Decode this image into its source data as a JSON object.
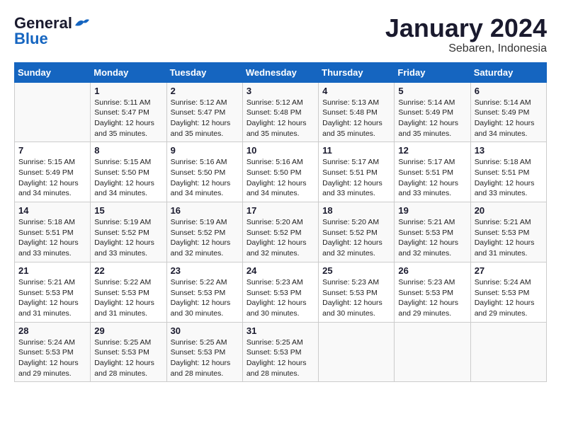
{
  "header": {
    "logo_line1": "General",
    "logo_line2": "Blue",
    "month": "January 2024",
    "location": "Sebaren, Indonesia"
  },
  "days_of_week": [
    "Sunday",
    "Monday",
    "Tuesday",
    "Wednesday",
    "Thursday",
    "Friday",
    "Saturday"
  ],
  "weeks": [
    [
      {
        "day": "",
        "info": ""
      },
      {
        "day": "1",
        "info": "Sunrise: 5:11 AM\nSunset: 5:47 PM\nDaylight: 12 hours\nand 35 minutes."
      },
      {
        "day": "2",
        "info": "Sunrise: 5:12 AM\nSunset: 5:47 PM\nDaylight: 12 hours\nand 35 minutes."
      },
      {
        "day": "3",
        "info": "Sunrise: 5:12 AM\nSunset: 5:48 PM\nDaylight: 12 hours\nand 35 minutes."
      },
      {
        "day": "4",
        "info": "Sunrise: 5:13 AM\nSunset: 5:48 PM\nDaylight: 12 hours\nand 35 minutes."
      },
      {
        "day": "5",
        "info": "Sunrise: 5:14 AM\nSunset: 5:49 PM\nDaylight: 12 hours\nand 35 minutes."
      },
      {
        "day": "6",
        "info": "Sunrise: 5:14 AM\nSunset: 5:49 PM\nDaylight: 12 hours\nand 34 minutes."
      }
    ],
    [
      {
        "day": "7",
        "info": "Sunrise: 5:15 AM\nSunset: 5:49 PM\nDaylight: 12 hours\nand 34 minutes."
      },
      {
        "day": "8",
        "info": "Sunrise: 5:15 AM\nSunset: 5:50 PM\nDaylight: 12 hours\nand 34 minutes."
      },
      {
        "day": "9",
        "info": "Sunrise: 5:16 AM\nSunset: 5:50 PM\nDaylight: 12 hours\nand 34 minutes."
      },
      {
        "day": "10",
        "info": "Sunrise: 5:16 AM\nSunset: 5:50 PM\nDaylight: 12 hours\nand 34 minutes."
      },
      {
        "day": "11",
        "info": "Sunrise: 5:17 AM\nSunset: 5:51 PM\nDaylight: 12 hours\nand 33 minutes."
      },
      {
        "day": "12",
        "info": "Sunrise: 5:17 AM\nSunset: 5:51 PM\nDaylight: 12 hours\nand 33 minutes."
      },
      {
        "day": "13",
        "info": "Sunrise: 5:18 AM\nSunset: 5:51 PM\nDaylight: 12 hours\nand 33 minutes."
      }
    ],
    [
      {
        "day": "14",
        "info": "Sunrise: 5:18 AM\nSunset: 5:51 PM\nDaylight: 12 hours\nand 33 minutes."
      },
      {
        "day": "15",
        "info": "Sunrise: 5:19 AM\nSunset: 5:52 PM\nDaylight: 12 hours\nand 33 minutes."
      },
      {
        "day": "16",
        "info": "Sunrise: 5:19 AM\nSunset: 5:52 PM\nDaylight: 12 hours\nand 32 minutes."
      },
      {
        "day": "17",
        "info": "Sunrise: 5:20 AM\nSunset: 5:52 PM\nDaylight: 12 hours\nand 32 minutes."
      },
      {
        "day": "18",
        "info": "Sunrise: 5:20 AM\nSunset: 5:52 PM\nDaylight: 12 hours\nand 32 minutes."
      },
      {
        "day": "19",
        "info": "Sunrise: 5:21 AM\nSunset: 5:53 PM\nDaylight: 12 hours\nand 32 minutes."
      },
      {
        "day": "20",
        "info": "Sunrise: 5:21 AM\nSunset: 5:53 PM\nDaylight: 12 hours\nand 31 minutes."
      }
    ],
    [
      {
        "day": "21",
        "info": "Sunrise: 5:21 AM\nSunset: 5:53 PM\nDaylight: 12 hours\nand 31 minutes."
      },
      {
        "day": "22",
        "info": "Sunrise: 5:22 AM\nSunset: 5:53 PM\nDaylight: 12 hours\nand 31 minutes."
      },
      {
        "day": "23",
        "info": "Sunrise: 5:22 AM\nSunset: 5:53 PM\nDaylight: 12 hours\nand 30 minutes."
      },
      {
        "day": "24",
        "info": "Sunrise: 5:23 AM\nSunset: 5:53 PM\nDaylight: 12 hours\nand 30 minutes."
      },
      {
        "day": "25",
        "info": "Sunrise: 5:23 AM\nSunset: 5:53 PM\nDaylight: 12 hours\nand 30 minutes."
      },
      {
        "day": "26",
        "info": "Sunrise: 5:23 AM\nSunset: 5:53 PM\nDaylight: 12 hours\nand 29 minutes."
      },
      {
        "day": "27",
        "info": "Sunrise: 5:24 AM\nSunset: 5:53 PM\nDaylight: 12 hours\nand 29 minutes."
      }
    ],
    [
      {
        "day": "28",
        "info": "Sunrise: 5:24 AM\nSunset: 5:53 PM\nDaylight: 12 hours\nand 29 minutes."
      },
      {
        "day": "29",
        "info": "Sunrise: 5:25 AM\nSunset: 5:53 PM\nDaylight: 12 hours\nand 28 minutes."
      },
      {
        "day": "30",
        "info": "Sunrise: 5:25 AM\nSunset: 5:53 PM\nDaylight: 12 hours\nand 28 minutes."
      },
      {
        "day": "31",
        "info": "Sunrise: 5:25 AM\nSunset: 5:53 PM\nDaylight: 12 hours\nand 28 minutes."
      },
      {
        "day": "",
        "info": ""
      },
      {
        "day": "",
        "info": ""
      },
      {
        "day": "",
        "info": ""
      }
    ]
  ]
}
